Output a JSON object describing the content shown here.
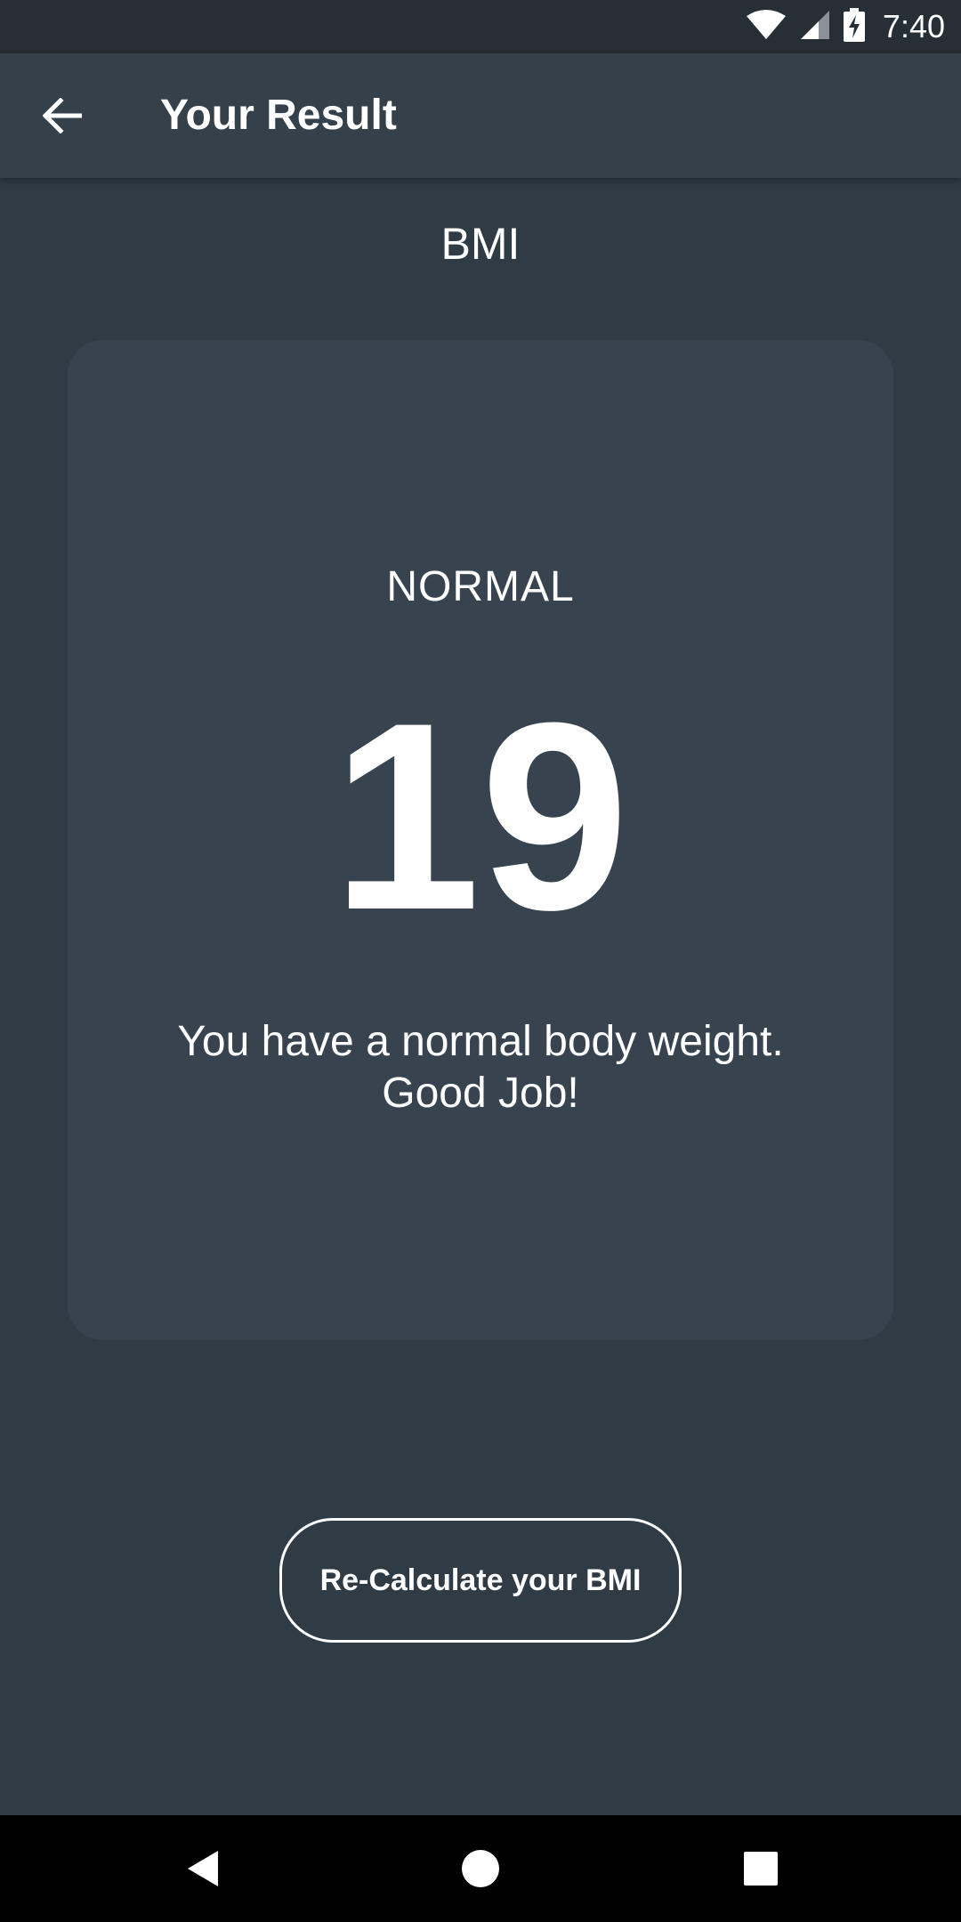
{
  "status_bar": {
    "time": "7:40",
    "icons": [
      "wifi-icon",
      "cell-signal-icon",
      "battery-charging-icon"
    ]
  },
  "app_bar": {
    "title": "Your Result",
    "back_icon": "arrow-back-icon"
  },
  "section_title": "BMI",
  "result_card": {
    "status": "NORMAL",
    "bmi_value": "19",
    "message": "You have a normal body weight. Good Job!"
  },
  "recalc_button": {
    "label": "Re-Calculate your BMI"
  },
  "nav_bar": {
    "buttons": [
      "back-triangle-icon",
      "home-circle-icon",
      "recents-square-icon"
    ]
  },
  "colors": {
    "background": "#2f3b45",
    "app_bar": "#34414b",
    "card": "#37444f",
    "status_bar": "#262f36",
    "text": "#ffffff"
  }
}
